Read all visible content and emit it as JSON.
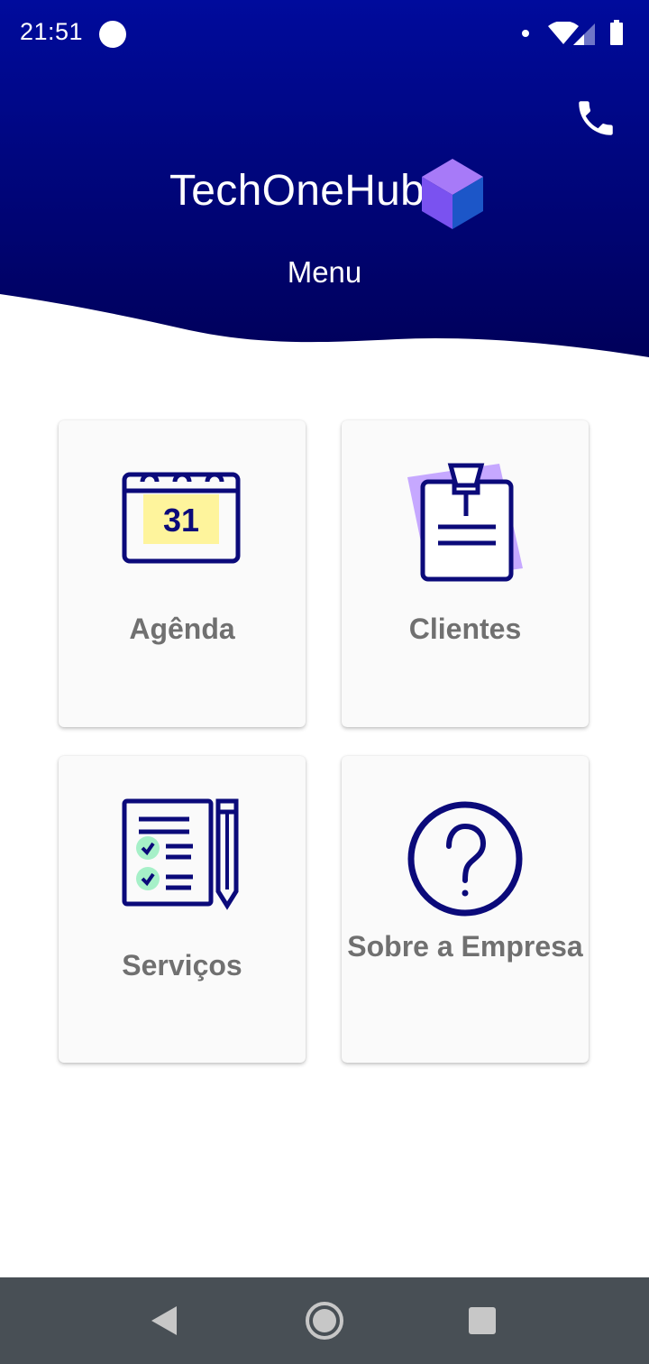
{
  "status_bar": {
    "time": "21:51",
    "icons": [
      "notification-circle-icon",
      "dot-icon",
      "wifi-icon",
      "signal-icon",
      "battery-icon"
    ]
  },
  "header": {
    "brand": "TechOneHub",
    "title": "Menu",
    "action_icon": "phone-icon",
    "colors": {
      "gradient_top": "#000b9c",
      "gradient_bottom": "#00005a",
      "text": "#ffffff",
      "cube_left": "#7a52f0",
      "cube_right": "#1c56c8",
      "cube_top": "#a77af8"
    }
  },
  "menu": {
    "items": [
      {
        "label": "Agênda",
        "icon": "calendar-icon",
        "icon_text": "31"
      },
      {
        "label": "Clientes",
        "icon": "clipboard-icon"
      },
      {
        "label": "Serviços",
        "icon": "checklist-icon"
      },
      {
        "label": "Sobre a Empresa",
        "icon": "question-icon"
      }
    ],
    "colors": {
      "label": "#707070",
      "icon_stroke": "#0b0a7a",
      "calendar_highlight": "#fef49c",
      "clipboard_back": "#c6a8ff",
      "check_fill": "#a6f0c8"
    }
  },
  "nav_bar": {
    "buttons": [
      "back-icon",
      "home-icon",
      "recent-apps-icon"
    ],
    "colors": {
      "background": "#484f55",
      "icon": "#c7c7c7"
    }
  }
}
